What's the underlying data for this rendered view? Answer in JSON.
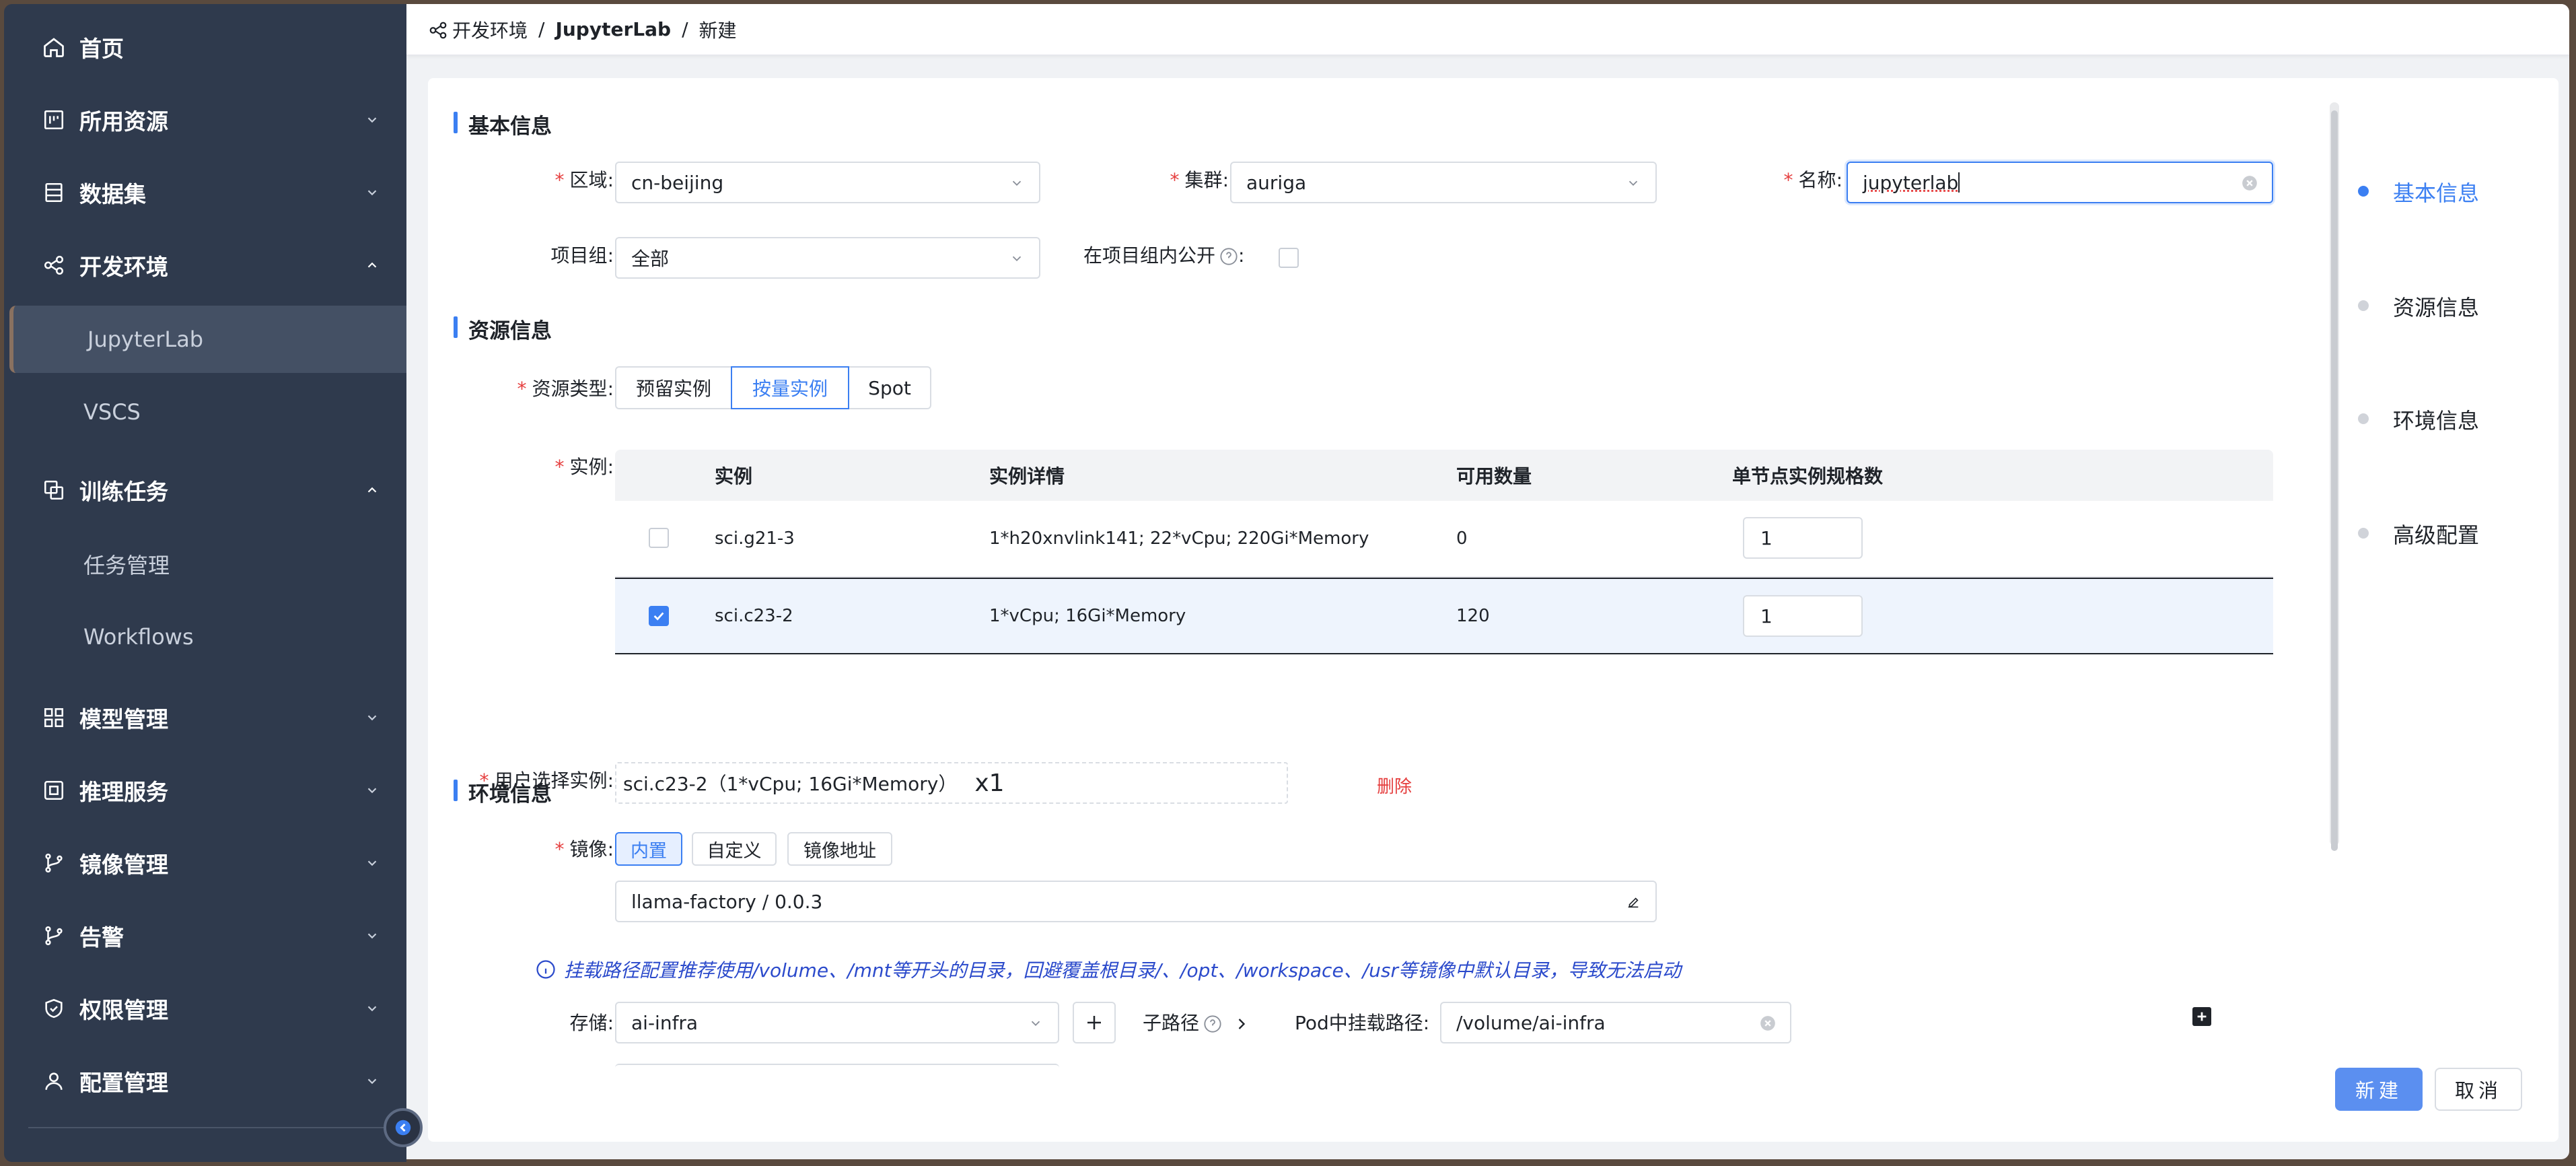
{
  "sidebar": {
    "items": [
      {
        "label": "首页",
        "icon": "home-icon"
      },
      {
        "label": "所用资源",
        "icon": "resource-icon"
      },
      {
        "label": "数据集",
        "icon": "dataset-icon"
      },
      {
        "label": "开发环境",
        "icon": "devenv-icon"
      },
      {
        "label": "训练任务",
        "icon": "training-icon"
      },
      {
        "label": "模型管理",
        "icon": "model-icon"
      },
      {
        "label": "推理服务",
        "icon": "inference-icon"
      },
      {
        "label": "镜像管理",
        "icon": "image-icon"
      },
      {
        "label": "告警",
        "icon": "alert-icon"
      },
      {
        "label": "权限管理",
        "icon": "permission-icon"
      },
      {
        "label": "配置管理",
        "icon": "config-icon"
      }
    ],
    "dev_sub": [
      "JupyterLab",
      "VSCS"
    ],
    "train_sub": [
      "任务管理",
      "Workflows"
    ]
  },
  "breadcrumb": {
    "root": "开发环境",
    "mid": "JupyterLab",
    "current": "新建"
  },
  "basic": {
    "title": "基本信息",
    "region_label": "区域",
    "region_value": "cn-beijing",
    "cluster_label": "集群",
    "cluster_value": "auriga",
    "name_label": "名称",
    "name_value": "jupyterlab",
    "group_label": "项目组",
    "group_value": "全部",
    "public_label": "在项目组内公开"
  },
  "resource": {
    "title": "资源信息",
    "type_label": "资源类型",
    "types": [
      "预留实例",
      "按量实例",
      "Spot"
    ],
    "selected_type": "按量实例",
    "instance_label": "实例",
    "columns": [
      "实例",
      "实例详情",
      "可用数量",
      "单节点实例规格数"
    ],
    "rows": [
      {
        "name": "sci.g21-3",
        "detail": "1*h20xnvlink141; 22*vCpu; 220Gi*Memory",
        "available": "0",
        "count": "1",
        "checked": false
      },
      {
        "name": "sci.c23-2",
        "detail": "1*vCpu; 16Gi*Memory",
        "available": "120",
        "count": "1",
        "checked": true
      }
    ],
    "user_selected_label": "用户选择实例",
    "user_selected_value": "sci.c23-2（1*vCpu; 16Gi*Memory）",
    "user_selected_mult": "x1",
    "delete_label": "删除"
  },
  "env": {
    "title": "环境信息",
    "image_label": "镜像",
    "image_options": [
      "内置",
      "自定义",
      "镜像地址"
    ],
    "image_selected": "内置",
    "image_value": "llama-factory / 0.0.3",
    "mount_tip": "挂载路径配置推荐使用/volume、/mnt等开头的目录，回避覆盖根目录/、/opt、/workspace、/usr等镜像中默认目录，导致无法启动",
    "storage_label": "存储",
    "storage_value": "ai-infra",
    "subpath_label": "子路径",
    "mount_label": "Pod中挂载路径",
    "mount_value": "/volume/ai-infra"
  },
  "anchor": [
    "基本信息",
    "资源信息",
    "环境信息",
    "高级配置"
  ],
  "actions": {
    "create": "新建",
    "cancel": "取消"
  },
  "colors": {
    "accent": "#3b7ff2",
    "sidebar": "#2f3a4d",
    "danger": "#e53e3e"
  }
}
